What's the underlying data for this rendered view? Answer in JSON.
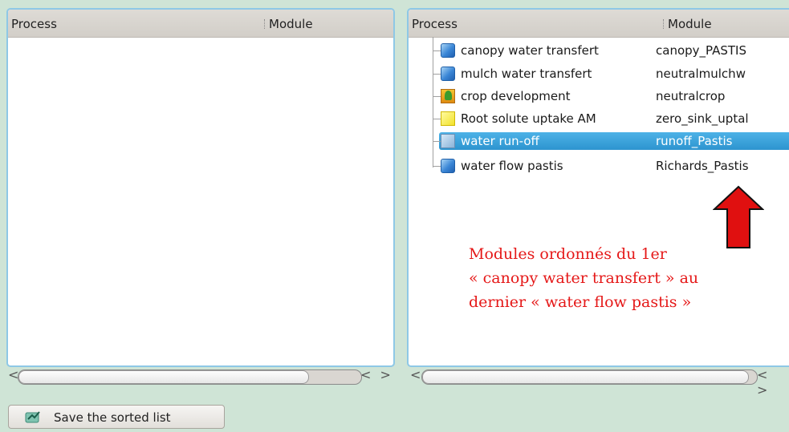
{
  "left_panel": {
    "headers": {
      "process": "Process",
      "module": "Module"
    },
    "scroll": {
      "left": "<",
      "right": "< >"
    }
  },
  "right_panel": {
    "headers": {
      "process": "Process",
      "module": "Module"
    },
    "rows": [
      {
        "process": "canopy water transfert",
        "module": "canopy_PASTIS",
        "icon": "blue-square-icon",
        "selected": false
      },
      {
        "process": "mulch water transfert",
        "module": "neutralmulchw",
        "icon": "blue-square-icon",
        "selected": false
      },
      {
        "process": "crop development",
        "module": "neutralcrop",
        "icon": "crop-plant-icon",
        "selected": false
      },
      {
        "process": "Root solute uptake AM",
        "module": "zero_sink_uptal",
        "icon": "yellow-square-icon",
        "selected": false
      },
      {
        "process": "water run-off",
        "module": "runoff_Pastis",
        "icon": "runoff-icon",
        "selected": true
      },
      {
        "process": "water flow pastis",
        "module": "Richards_Pastis",
        "icon": "blue-square-icon",
        "selected": false
      }
    ],
    "annotation": {
      "line1": "Modules ordonnés du 1er",
      "line2": "« canopy water transfert » au",
      "line3": "dernier « water flow pastis »"
    },
    "scroll": {
      "left": "<",
      "right": "< >"
    }
  },
  "save_button": {
    "label": "Save the sorted list",
    "icon": "save-sort-icon"
  },
  "colors": {
    "selection": "#3aa0dc",
    "annotation": "#e51818",
    "arrow": "#e01010",
    "pane_border": "#8ec8e6",
    "background": "#cfe4d6"
  }
}
